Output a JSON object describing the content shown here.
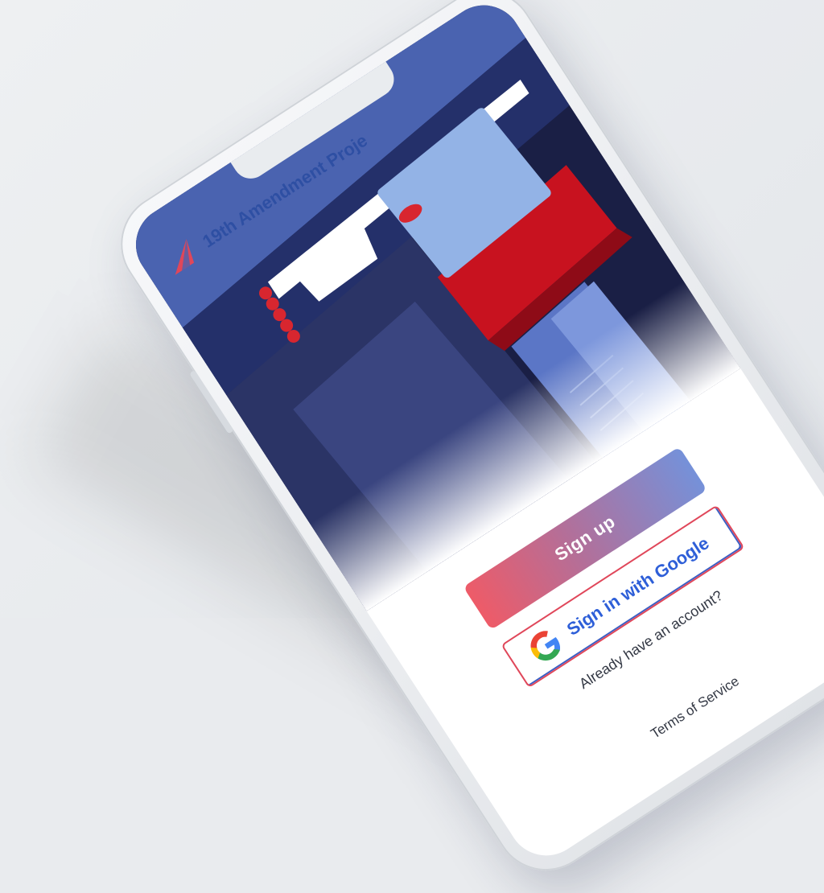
{
  "app": {
    "title": "19th Amendment Proje"
  },
  "auth": {
    "signup_label": "Sign up",
    "google_label": "Sign in with Google",
    "account_link": "Already have an account?",
    "tos_link": "Terms of Service"
  },
  "colors": {
    "brand_blue": "#2e4fa3",
    "accent_red": "#e0475a",
    "google_text": "#2e5fd8",
    "illustration_navy": "#1a1f45",
    "illustration_blue": "#4a63b0"
  },
  "icons": [
    "logo-icon",
    "google-icon"
  ]
}
